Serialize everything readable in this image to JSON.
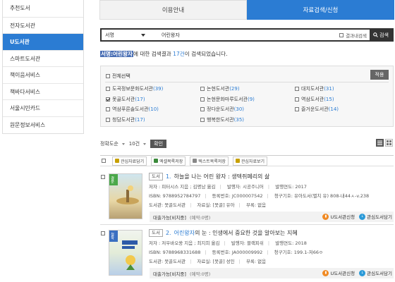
{
  "sidebar": {
    "items": [
      {
        "label": "추천도서",
        "active": false
      },
      {
        "label": "전자도서관",
        "active": false
      },
      {
        "label": "U도서관",
        "active": true
      },
      {
        "label": "스마트도서관",
        "active": false
      },
      {
        "label": "책이음서비스",
        "active": false
      },
      {
        "label": "책바다서비스",
        "active": false
      },
      {
        "label": "서울시민카드",
        "active": false
      },
      {
        "label": "원문정보서비스",
        "active": false
      }
    ]
  },
  "tabs": [
    {
      "label": "이용안내",
      "active": false
    },
    {
      "label": "자료검색/신청",
      "active": true
    }
  ],
  "search": {
    "field": "서명",
    "query": "어린왕자",
    "within_label": "결과내검색",
    "button_label": "검색"
  },
  "result_summary": {
    "query_label": "서명:어린왕자",
    "text1": "에 대한 검색결과 ",
    "count": "17건",
    "text2": "이 검색되었습니다."
  },
  "library_filter": {
    "select_all_label": "전체선택",
    "apply_label": "적용",
    "libraries": [
      {
        "name": "도곡정보문화도서관",
        "count": "(39)",
        "checked": false
      },
      {
        "name": "논현도서관",
        "count": "(29)",
        "checked": false
      },
      {
        "name": "대치도서관",
        "count": "(31)",
        "checked": false
      },
      {
        "name": "못골도서관",
        "count": "(17)",
        "checked": true
      },
      {
        "name": "논현문화마루도서관",
        "count": "(9)",
        "checked": false
      },
      {
        "name": "역삼도서관",
        "count": "(15)",
        "checked": false
      },
      {
        "name": "역삼푸른솔도서관",
        "count": "(10)",
        "checked": false
      },
      {
        "name": "정다운도서관",
        "count": "(30)",
        "checked": false
      },
      {
        "name": "즐거운도서관",
        "count": "(14)",
        "checked": false
      },
      {
        "name": "청담도서관",
        "count": "(17)",
        "checked": false
      },
      {
        "name": "행복한도서관",
        "count": "(35)",
        "checked": false
      }
    ]
  },
  "sort": {
    "order": "정확도순",
    "per_page": "10건",
    "confirm": "확인"
  },
  "actions": [
    {
      "label": "관심자료담기"
    },
    {
      "label": "엑셀목록저장"
    },
    {
      "label": "텍스트목록저장"
    },
    {
      "label": "관심자료보기"
    }
  ],
  "results": [
    {
      "type_tag": "도서",
      "number": "1.",
      "title": "하늘을 나는 어린 왕자 : 생텍쥐페리의 삶",
      "author": "저자 : 피터시스 지음 ; 김명남 옮김",
      "publisher": "발행자: 시공주니어",
      "year": "발행연도: 2017",
      "isbn": "ISBN: 9788952784797",
      "reg": "등록번호: JC000007542",
      "call": "청구기호: 유아도서(별치 유) 808-내44ㅅ-v.238",
      "library": "도서관: 못골도서관",
      "room": "자료실: [못골] 유아",
      "appendix": "부록: 없음",
      "avail": "대출가능[비치중]",
      "reserve": "(예약:0명)",
      "cover_ribbon": "경문",
      "btn_u": "U도서관신청",
      "btn_fav": "관심도서담기"
    },
    {
      "type_tag": "도서",
      "number": "2.",
      "title_highlight": "어린왕자",
      "title": "의 눈 : 인생에서 중요한 것을 알아보는 지혜",
      "author": "저자 : 저우바오쑹 지음 ; 최지희 옮김",
      "publisher": "발행자: 블랙피쉬",
      "year": "발행연도: 2018",
      "isbn": "ISBN: 9788968331688",
      "reg": "등록번호: JA000009992",
      "call": "청구기호: 199.1-저66ㅇ",
      "library": "도서관: 못골도서관",
      "room": "자료실: [못골] 성인",
      "appendix": "부록: 없음",
      "avail": "대출가능[비치중]",
      "reserve": "(예약:0명)",
      "cover_ribbon": "철학",
      "btn_u": "U도서관신청",
      "btn_fav": "관심도서담기"
    }
  ],
  "colors": {
    "accent": "#2b7cd3",
    "dark": "#333333",
    "orange": "#f08a24"
  }
}
